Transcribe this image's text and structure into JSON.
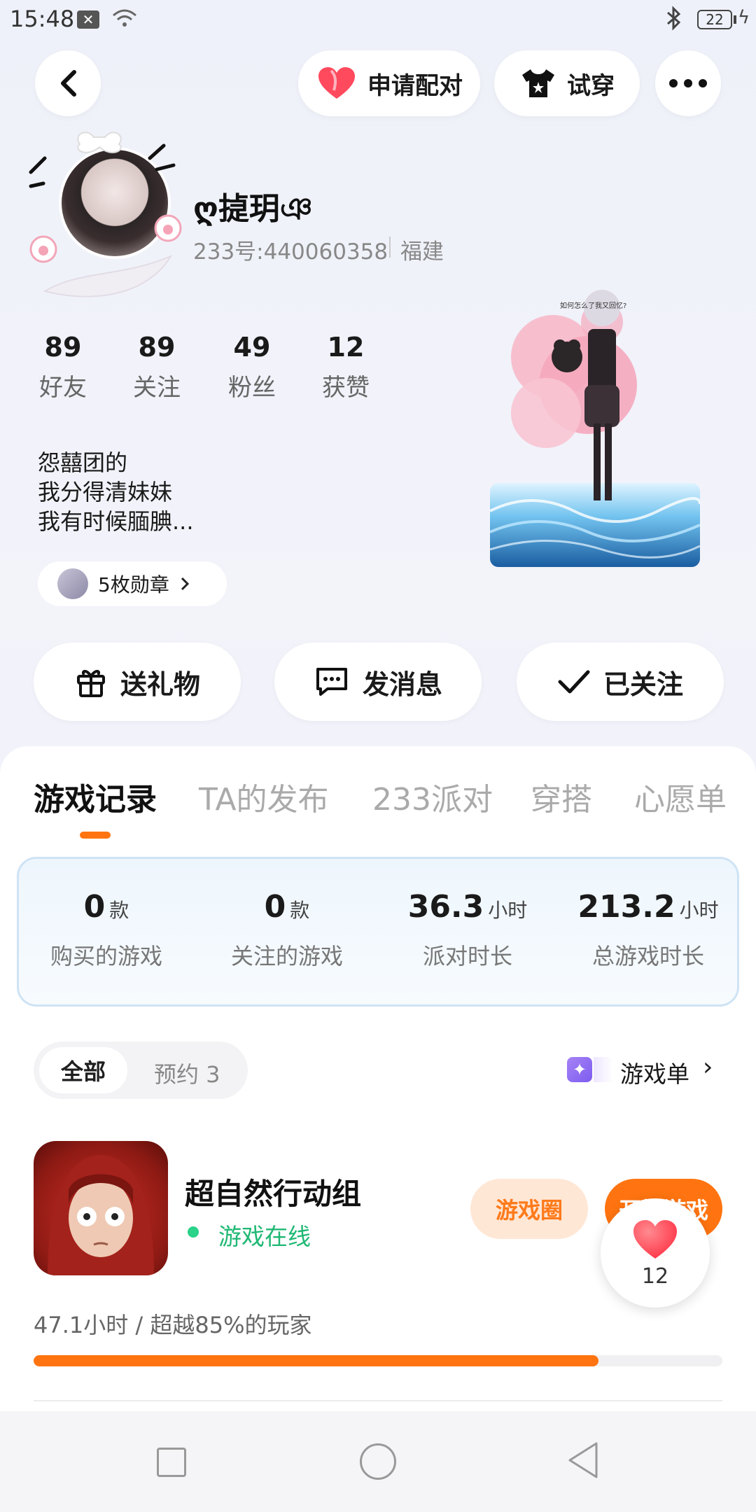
{
  "status_bar": {
    "time": "15:48",
    "battery": "22"
  },
  "top_actions": {
    "pair_label": "申请配对",
    "try_label": "试穿"
  },
  "profile": {
    "username": "ღ㨗玥ঞ",
    "user_id": "233号:440060358",
    "region": "福建",
    "stats": [
      {
        "value": "89",
        "label": "好友"
      },
      {
        "value": "89",
        "label": "关注"
      },
      {
        "value": "49",
        "label": "粉丝"
      },
      {
        "value": "12",
        "label": "获赞"
      }
    ],
    "bio_lines": [
      "怨囍团的",
      "我分得清妹妹",
      "我有时候腼腆..."
    ],
    "medal_label": "5枚勋章"
  },
  "character": {
    "caption": "如何怎么了我又回忆?"
  },
  "actions": {
    "gift": "送礼物",
    "message": "发消息",
    "following": "已关注"
  },
  "tabs": [
    {
      "label": "游戏记录",
      "active": true
    },
    {
      "label": "TA的发布",
      "active": false
    },
    {
      "label": "233派对",
      "active": false
    },
    {
      "label": "穿搭",
      "active": false
    },
    {
      "label": "心愿单",
      "active": false
    }
  ],
  "game_stats": [
    {
      "value": "0",
      "unit": "款",
      "label": "购买的游戏"
    },
    {
      "value": "0",
      "unit": "款",
      "label": "关注的游戏"
    },
    {
      "value": "36.3",
      "unit": "小时",
      "label": "派对时长"
    },
    {
      "value": "213.2",
      "unit": "小时",
      "label": "总游戏时长"
    }
  ],
  "filters": {
    "all": "全部",
    "preorder": "预约 3"
  },
  "game_list_label": "游戏单",
  "game": {
    "title": "超自然行动组",
    "status": "游戏在线",
    "circle_label": "游戏圈",
    "play_label": "开始游戏",
    "playtime": "47.1小时 / 超越85%的玩家",
    "progress_fraction": 0.82
  },
  "like_count": "12",
  "colors": {
    "accent": "#ff7410",
    "online": "#1fb873",
    "heart": "#ff4a5e"
  }
}
